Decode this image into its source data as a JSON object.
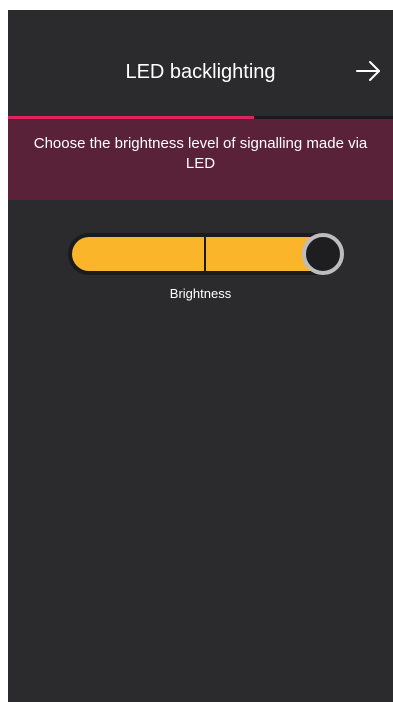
{
  "header": {
    "title": "LED backlighting",
    "next_icon": "arrow-right-icon"
  },
  "progress": {
    "fraction": 0.64,
    "color": "#e0235a"
  },
  "banner": {
    "text": "Choose the brightness level of signalling made via LED",
    "color": "#5a2238"
  },
  "brightness": {
    "label": "Brightness",
    "level": 1.0,
    "fill_color": "#fbb52a"
  }
}
